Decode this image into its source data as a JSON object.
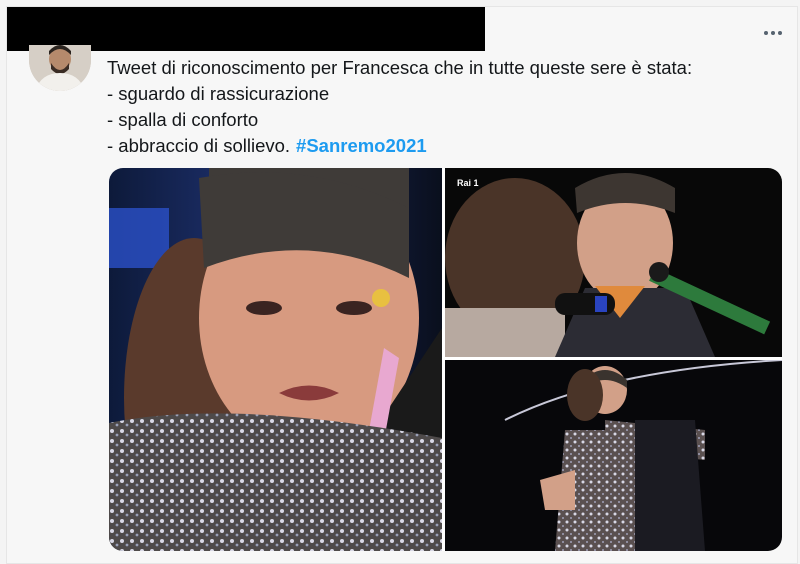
{
  "tweet": {
    "lines": [
      "Tweet di riconoscimento per Francesca che in tutte queste sere è stata:",
      "- sguardo di rassicurazione",
      "- spalla di conforto",
      "- abbraccio di sollievo."
    ],
    "hashtag": "#Sanremo2021"
  },
  "media": {
    "broadcaster_logo": "Rai 1",
    "photos": [
      "man-crying-close-up",
      "couple-with-microphone",
      "couple-embracing-on-stage"
    ]
  },
  "colors": {
    "hashtag": "#1d9bf0",
    "text": "#14171a",
    "redaction": "#000000"
  },
  "icons": {
    "more": "more-options-icon"
  }
}
